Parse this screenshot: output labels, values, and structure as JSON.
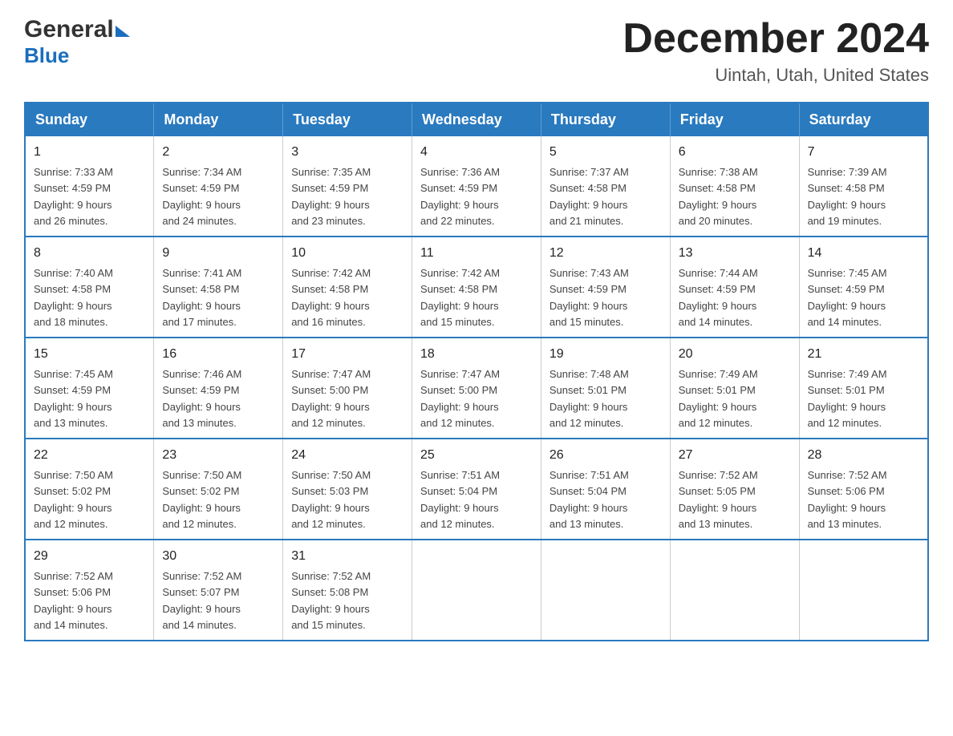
{
  "header": {
    "logo_general": "General",
    "logo_blue": "Blue",
    "month_title": "December 2024",
    "location": "Uintah, Utah, United States"
  },
  "days_of_week": [
    "Sunday",
    "Monday",
    "Tuesday",
    "Wednesday",
    "Thursday",
    "Friday",
    "Saturday"
  ],
  "weeks": [
    [
      {
        "day": "1",
        "sunrise": "7:33 AM",
        "sunset": "4:59 PM",
        "daylight": "9 hours and 26 minutes."
      },
      {
        "day": "2",
        "sunrise": "7:34 AM",
        "sunset": "4:59 PM",
        "daylight": "9 hours and 24 minutes."
      },
      {
        "day": "3",
        "sunrise": "7:35 AM",
        "sunset": "4:59 PM",
        "daylight": "9 hours and 23 minutes."
      },
      {
        "day": "4",
        "sunrise": "7:36 AM",
        "sunset": "4:59 PM",
        "daylight": "9 hours and 22 minutes."
      },
      {
        "day": "5",
        "sunrise": "7:37 AM",
        "sunset": "4:58 PM",
        "daylight": "9 hours and 21 minutes."
      },
      {
        "day": "6",
        "sunrise": "7:38 AM",
        "sunset": "4:58 PM",
        "daylight": "9 hours and 20 minutes."
      },
      {
        "day": "7",
        "sunrise": "7:39 AM",
        "sunset": "4:58 PM",
        "daylight": "9 hours and 19 minutes."
      }
    ],
    [
      {
        "day": "8",
        "sunrise": "7:40 AM",
        "sunset": "4:58 PM",
        "daylight": "9 hours and 18 minutes."
      },
      {
        "day": "9",
        "sunrise": "7:41 AM",
        "sunset": "4:58 PM",
        "daylight": "9 hours and 17 minutes."
      },
      {
        "day": "10",
        "sunrise": "7:42 AM",
        "sunset": "4:58 PM",
        "daylight": "9 hours and 16 minutes."
      },
      {
        "day": "11",
        "sunrise": "7:42 AM",
        "sunset": "4:58 PM",
        "daylight": "9 hours and 15 minutes."
      },
      {
        "day": "12",
        "sunrise": "7:43 AM",
        "sunset": "4:59 PM",
        "daylight": "9 hours and 15 minutes."
      },
      {
        "day": "13",
        "sunrise": "7:44 AM",
        "sunset": "4:59 PM",
        "daylight": "9 hours and 14 minutes."
      },
      {
        "day": "14",
        "sunrise": "7:45 AM",
        "sunset": "4:59 PM",
        "daylight": "9 hours and 14 minutes."
      }
    ],
    [
      {
        "day": "15",
        "sunrise": "7:45 AM",
        "sunset": "4:59 PM",
        "daylight": "9 hours and 13 minutes."
      },
      {
        "day": "16",
        "sunrise": "7:46 AM",
        "sunset": "4:59 PM",
        "daylight": "9 hours and 13 minutes."
      },
      {
        "day": "17",
        "sunrise": "7:47 AM",
        "sunset": "5:00 PM",
        "daylight": "9 hours and 12 minutes."
      },
      {
        "day": "18",
        "sunrise": "7:47 AM",
        "sunset": "5:00 PM",
        "daylight": "9 hours and 12 minutes."
      },
      {
        "day": "19",
        "sunrise": "7:48 AM",
        "sunset": "5:01 PM",
        "daylight": "9 hours and 12 minutes."
      },
      {
        "day": "20",
        "sunrise": "7:49 AM",
        "sunset": "5:01 PM",
        "daylight": "9 hours and 12 minutes."
      },
      {
        "day": "21",
        "sunrise": "7:49 AM",
        "sunset": "5:01 PM",
        "daylight": "9 hours and 12 minutes."
      }
    ],
    [
      {
        "day": "22",
        "sunrise": "7:50 AM",
        "sunset": "5:02 PM",
        "daylight": "9 hours and 12 minutes."
      },
      {
        "day": "23",
        "sunrise": "7:50 AM",
        "sunset": "5:02 PM",
        "daylight": "9 hours and 12 minutes."
      },
      {
        "day": "24",
        "sunrise": "7:50 AM",
        "sunset": "5:03 PM",
        "daylight": "9 hours and 12 minutes."
      },
      {
        "day": "25",
        "sunrise": "7:51 AM",
        "sunset": "5:04 PM",
        "daylight": "9 hours and 12 minutes."
      },
      {
        "day": "26",
        "sunrise": "7:51 AM",
        "sunset": "5:04 PM",
        "daylight": "9 hours and 13 minutes."
      },
      {
        "day": "27",
        "sunrise": "7:52 AM",
        "sunset": "5:05 PM",
        "daylight": "9 hours and 13 minutes."
      },
      {
        "day": "28",
        "sunrise": "7:52 AM",
        "sunset": "5:06 PM",
        "daylight": "9 hours and 13 minutes."
      }
    ],
    [
      {
        "day": "29",
        "sunrise": "7:52 AM",
        "sunset": "5:06 PM",
        "daylight": "9 hours and 14 minutes."
      },
      {
        "day": "30",
        "sunrise": "7:52 AM",
        "sunset": "5:07 PM",
        "daylight": "9 hours and 14 minutes."
      },
      {
        "day": "31",
        "sunrise": "7:52 AM",
        "sunset": "5:08 PM",
        "daylight": "9 hours and 15 minutes."
      },
      null,
      null,
      null,
      null
    ]
  ]
}
